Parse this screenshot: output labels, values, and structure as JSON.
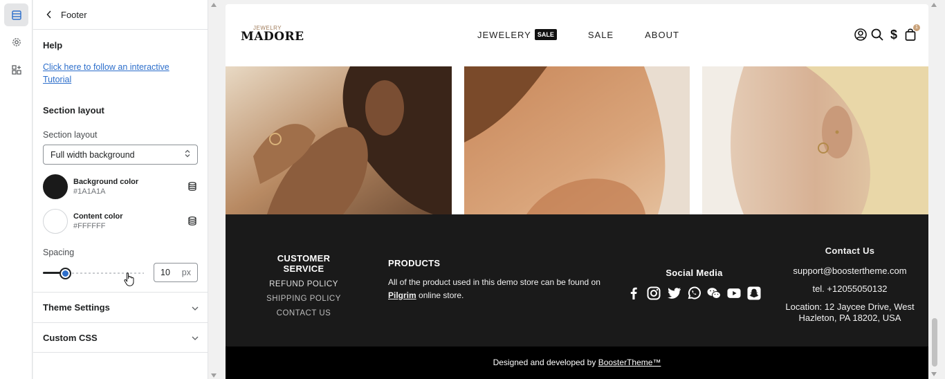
{
  "rail": {
    "items": [
      {
        "icon": "sections-icon"
      },
      {
        "icon": "gear-icon"
      },
      {
        "icon": "apps-icon"
      }
    ]
  },
  "panel": {
    "header_title": "Footer",
    "help": {
      "title": "Help",
      "link_text": "Click here to follow an interactive Tutorial"
    },
    "section_layout": {
      "title": "Section layout",
      "label": "Section layout",
      "selected": "Full width background"
    },
    "background_color": {
      "name": "Background color",
      "value": "#1A1A1A"
    },
    "content_color": {
      "name": "Content color",
      "value": "#FFFFFF"
    },
    "spacing": {
      "label": "Spacing",
      "value": "10",
      "unit": "px",
      "slider_fraction": 0.22
    },
    "theme_settings": "Theme Settings",
    "custom_css": "Custom CSS"
  },
  "site": {
    "logo_small": "JEWELRY",
    "logo_big": "MADORE",
    "nav": [
      {
        "label": "JEWELERY",
        "badge": "SALE"
      },
      {
        "label": "SALE"
      },
      {
        "label": "ABOUT"
      }
    ],
    "header_icons": [
      "account-icon",
      "search-icon",
      "currency-icon",
      "cart-icon"
    ],
    "cart_count": "1"
  },
  "footer": {
    "customer_service": {
      "title": "CUSTOMER SERVICE",
      "links": [
        "REFUND POLICY",
        "SHIPPING POLICY",
        "CONTACT US"
      ]
    },
    "products": {
      "title": "PRODUCTS",
      "text_before": "All of the product used in this demo store can be found on",
      "link": " Pilgrim",
      "text_after": " online store."
    },
    "social": {
      "title": "Social Media",
      "icons": [
        "facebook-icon",
        "instagram-icon",
        "twitter-icon",
        "whatsapp-icon",
        "wechat-icon",
        "youtube-icon",
        "snapchat-icon"
      ]
    },
    "contact": {
      "title": "Contact Us",
      "email": "support@boostertheme.com",
      "phone": "tel. +12055050132",
      "location": "Location: 12 Jaycee Drive, West Hazleton, PA 18202, USA"
    },
    "bottom": {
      "prefix": "Designed and developed by ",
      "link": "BoosterTheme™"
    }
  },
  "colors": {
    "accent": "#2c6ecb",
    "footer_bg": "#1A1A1A",
    "bottom_bar": "#000000"
  }
}
